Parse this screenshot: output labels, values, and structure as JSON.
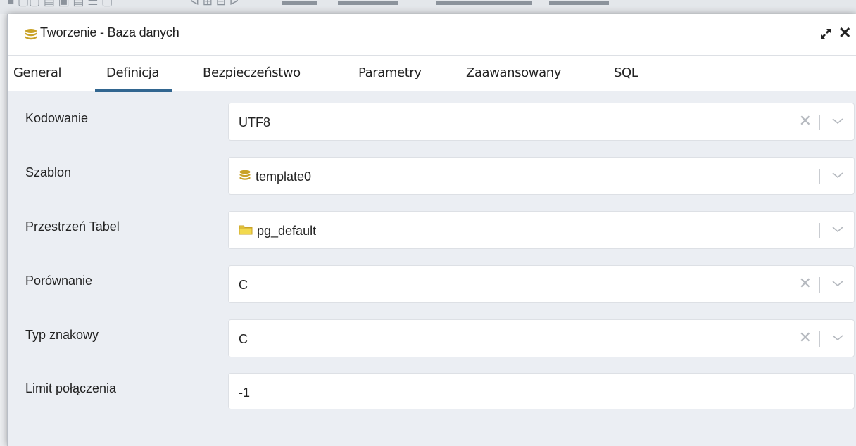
{
  "dialog": {
    "title": "Tworzenie - Baza danych",
    "title_icon": "database-icon",
    "expand_icon": "expand-icon",
    "close_icon": "close-icon",
    "close_glyph": "✕"
  },
  "tabs": [
    {
      "label": "General",
      "active": false
    },
    {
      "label": "Definicja",
      "active": true
    },
    {
      "label": "Bezpieczeństwo",
      "active": false
    },
    {
      "label": "Parametry",
      "active": false
    },
    {
      "label": "Zaawansowany",
      "active": false
    },
    {
      "label": "SQL",
      "active": false
    }
  ],
  "fields": [
    {
      "label": "Kodowanie",
      "value": "UTF8",
      "icon": "",
      "clearable": true,
      "dropdown": true
    },
    {
      "label": "Szablon",
      "value": "template0",
      "icon": "database-icon",
      "clearable": false,
      "dropdown": true
    },
    {
      "label": "Przestrzeń Tabel",
      "value": "pg_default",
      "icon": "folder-icon",
      "clearable": false,
      "dropdown": true
    },
    {
      "label": "Porównanie",
      "value": "C",
      "icon": "",
      "clearable": true,
      "dropdown": true
    },
    {
      "label": "Typ znakowy",
      "value": "C",
      "icon": "",
      "clearable": true,
      "dropdown": true
    },
    {
      "label": "Limit połączenia",
      "value": "-1",
      "icon": "",
      "clearable": false,
      "dropdown": false
    }
  ],
  "colors": {
    "accent": "#326690",
    "database_icon": "#c9a227",
    "folder_icon": "#f2d94e"
  }
}
